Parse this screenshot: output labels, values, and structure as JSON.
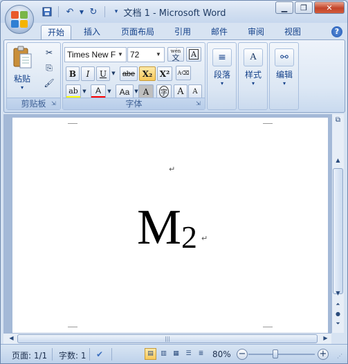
{
  "window": {
    "title": "文档 1 - Microsoft Word"
  },
  "tabs": [
    {
      "label": "开始",
      "active": true
    },
    {
      "label": "插入"
    },
    {
      "label": "页面布局"
    },
    {
      "label": "引用"
    },
    {
      "label": "邮件"
    },
    {
      "label": "审阅"
    },
    {
      "label": "视图"
    }
  ],
  "ribbon": {
    "clipboard": {
      "label": "剪贴板",
      "paste": "粘贴"
    },
    "font": {
      "label": "字体",
      "font_name": "Times New F",
      "font_size": "72",
      "wen": "wén",
      "wen_char": "文",
      "bold": "B",
      "italic": "I",
      "underline": "U",
      "strike": "abe",
      "subscript": "X₂",
      "superscript": "X²",
      "change_case": "Aa",
      "char_shade": "A",
      "enclose": "字",
      "grow": "A",
      "shrink": "A",
      "highlight": "ab",
      "font_color": "A"
    },
    "paragraph": {
      "label": "段落"
    },
    "styles": {
      "label": "样式"
    },
    "editing": {
      "label": "编辑"
    }
  },
  "document": {
    "main_text": "M",
    "subscript_text": "2",
    "para_mark": "↵"
  },
  "statusbar": {
    "page": "页面: 1/1",
    "words": "字数: 1",
    "zoom": "80%",
    "zoom_percent": 80
  },
  "colors": {
    "accent": "#15428b",
    "highlight": "#ffff00",
    "font_color": "#ff0000"
  }
}
